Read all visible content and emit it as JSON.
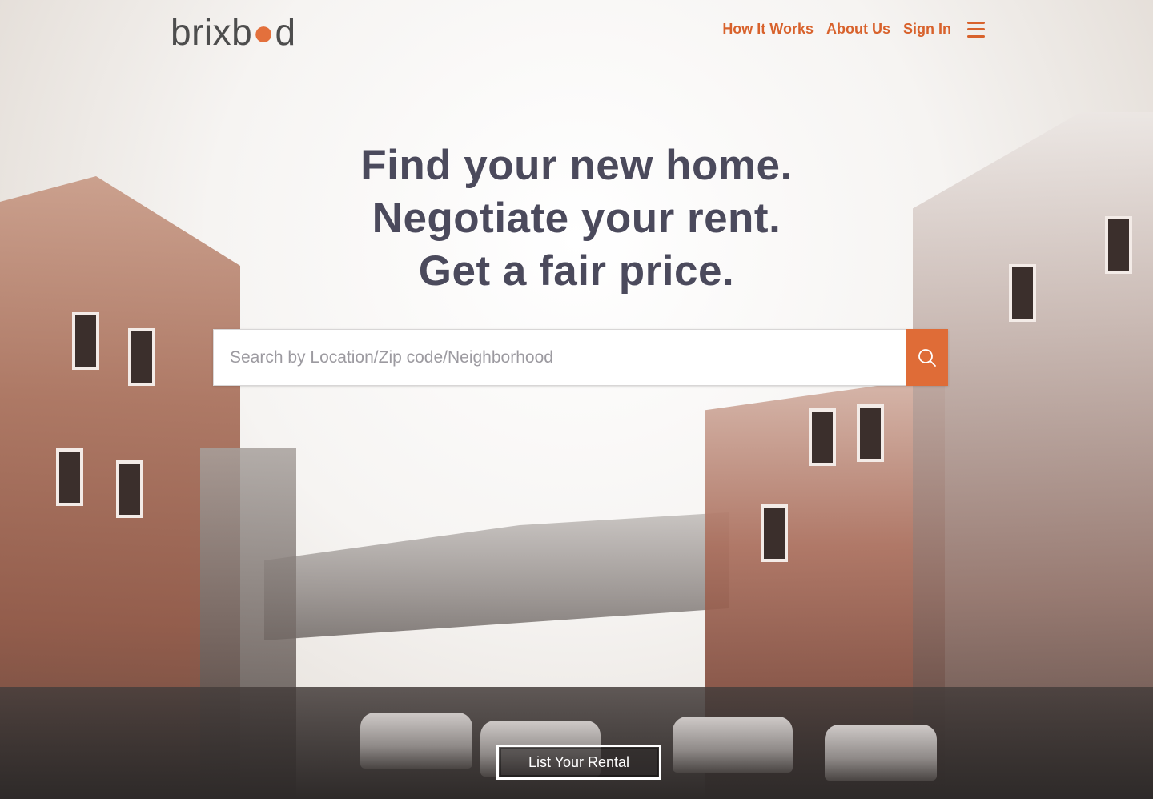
{
  "header": {
    "logo": {
      "text_before": "brixb",
      "pin_char": "●",
      "text_after": "d"
    },
    "nav": {
      "how_it_works": "How It Works",
      "about_us": "About Us",
      "sign_in": "Sign In",
      "menu_icon": "hamburger-menu-icon"
    }
  },
  "hero": {
    "line1": "Find your new home.",
    "line2": "Negotiate your rent.",
    "line3": "Get a fair price."
  },
  "search": {
    "placeholder": "Search by Location/Zip code/Neighborhood",
    "value": "",
    "button_icon": "search-icon"
  },
  "cta": {
    "list_rental": "List Your Rental"
  },
  "colors": {
    "accent": "#df6c37",
    "nav_text": "#d8622c",
    "headline": "#4b4a5c"
  }
}
